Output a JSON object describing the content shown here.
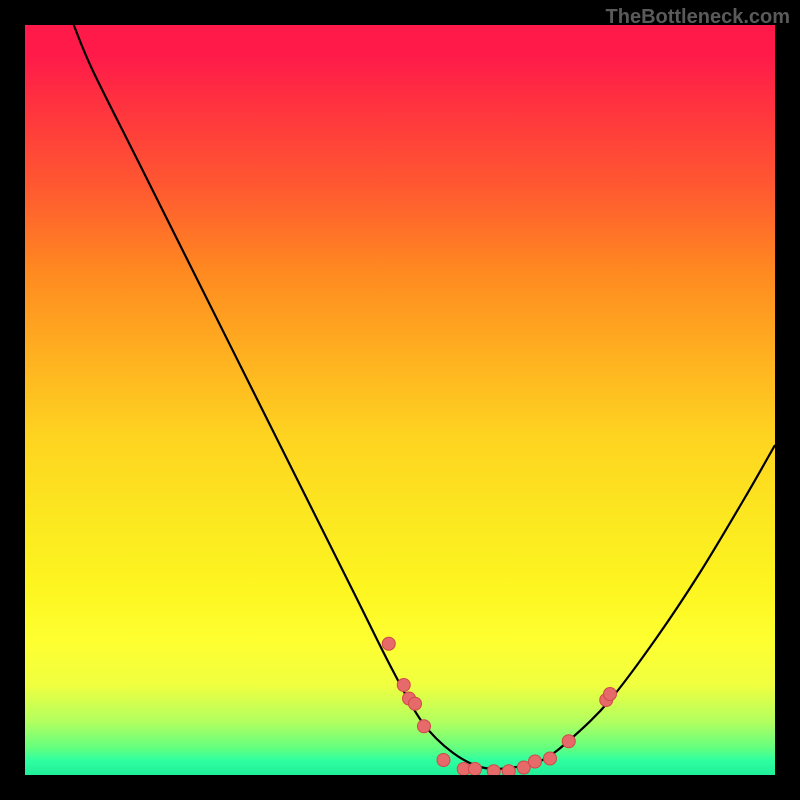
{
  "watermark": "TheBottleneck.com",
  "chart_data": {
    "type": "line",
    "title": "",
    "xlabel": "",
    "ylabel": "",
    "xlim": [
      0,
      100
    ],
    "ylim": [
      0,
      100
    ],
    "curve": [
      {
        "x": 6.5,
        "y": 100
      },
      {
        "x": 9,
        "y": 94
      },
      {
        "x": 15,
        "y": 82
      },
      {
        "x": 22,
        "y": 68
      },
      {
        "x": 30,
        "y": 52
      },
      {
        "x": 38,
        "y": 36
      },
      {
        "x": 44,
        "y": 24
      },
      {
        "x": 49,
        "y": 14
      },
      {
        "x": 53,
        "y": 7
      },
      {
        "x": 57,
        "y": 3
      },
      {
        "x": 61,
        "y": 1
      },
      {
        "x": 65,
        "y": 1
      },
      {
        "x": 69,
        "y": 2
      },
      {
        "x": 73,
        "y": 5
      },
      {
        "x": 78,
        "y": 10
      },
      {
        "x": 84,
        "y": 18
      },
      {
        "x": 90,
        "y": 27
      },
      {
        "x": 96,
        "y": 37
      },
      {
        "x": 100,
        "y": 44
      }
    ],
    "dots": [
      {
        "x": 48.5,
        "y": 17.5
      },
      {
        "x": 50.5,
        "y": 12.0
      },
      {
        "x": 51.2,
        "y": 10.2
      },
      {
        "x": 52.0,
        "y": 9.5
      },
      {
        "x": 53.2,
        "y": 6.5
      },
      {
        "x": 55.8,
        "y": 2.0
      },
      {
        "x": 58.5,
        "y": 0.8
      },
      {
        "x": 60.0,
        "y": 0.8
      },
      {
        "x": 62.5,
        "y": 0.5
      },
      {
        "x": 64.5,
        "y": 0.5
      },
      {
        "x": 66.5,
        "y": 1.0
      },
      {
        "x": 68.0,
        "y": 1.8
      },
      {
        "x": 70.0,
        "y": 2.2
      },
      {
        "x": 72.5,
        "y": 4.5
      },
      {
        "x": 77.5,
        "y": 10.0
      },
      {
        "x": 78.0,
        "y": 10.8
      }
    ],
    "colors": {
      "curve": "#000000",
      "dot_fill": "#e76a6a",
      "dot_stroke": "#d04848"
    }
  }
}
